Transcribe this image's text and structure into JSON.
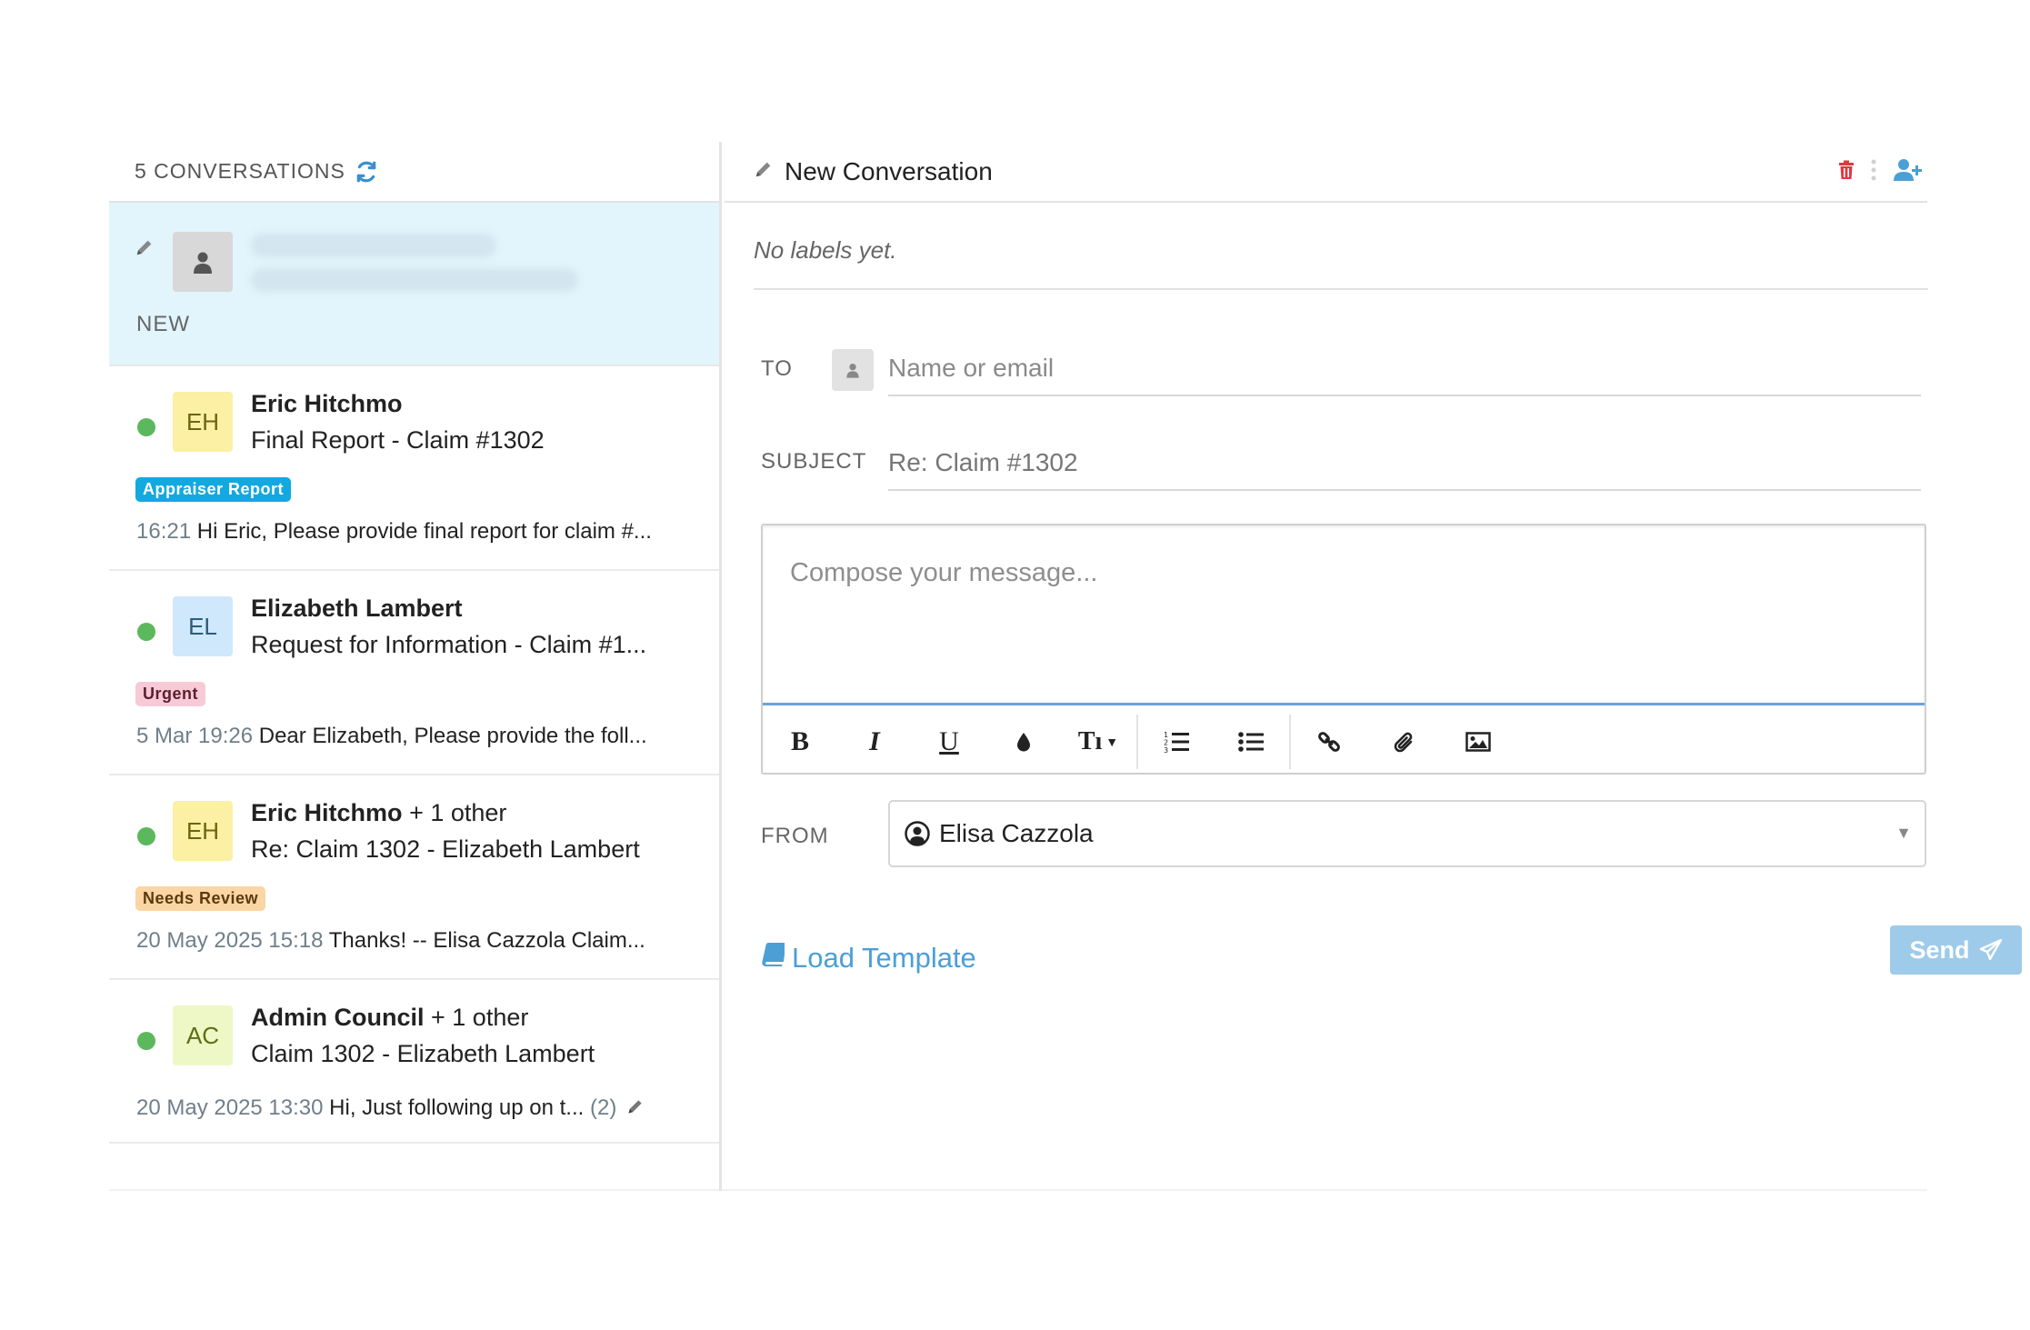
{
  "conversations_header": {
    "count_label": "5 CONVERSATIONS",
    "refresh_icon": "refresh-icon"
  },
  "new_item": {
    "label": "NEW"
  },
  "conversations": [
    {
      "initials": "EH",
      "name": "Eric Hitchmo",
      "extra": "",
      "subject": "Final Report - Claim #1302",
      "label": "Appraiser Report",
      "label_color": "#12a9e0",
      "time": "16:21",
      "preview": "Hi Eric, Please provide final report for claim #...",
      "status_color": "#5cb85c"
    },
    {
      "initials": "EL",
      "name": "Elizabeth Lambert",
      "extra": "",
      "subject": "Request for Information - Claim #1...",
      "label": "Urgent",
      "label_color": "#f8cad7",
      "time": "5 Mar 19:26",
      "preview": "Dear Elizabeth, Please provide the foll...",
      "status_color": "#5cb85c"
    },
    {
      "initials": "EH",
      "name": "Eric Hitchmo",
      "extra": "+ 1 other",
      "subject": "Re: Claim 1302 - Elizabeth Lambert",
      "label": "Needs Review",
      "label_color": "#fbd5a3",
      "time": "20 May 2025 15:18",
      "preview": "Thanks! -- Elisa Cazzola Claim...",
      "status_color": "#5cb85c"
    },
    {
      "initials": "AC",
      "name": "Admin Council",
      "extra": "+ 1 other",
      "subject": "Claim 1302 - Elizabeth Lambert",
      "label": "",
      "time": "20 May 2025 13:30",
      "preview": "Hi, Just following up on t...",
      "count": "(2)",
      "status_color": "#5cb85c"
    }
  ],
  "compose": {
    "title": "New Conversation",
    "no_labels": "No labels yet.",
    "to_label": "TO",
    "to_placeholder": "Name or email",
    "subject_label": "SUBJECT",
    "subject_value": "Re: Claim #1302",
    "message_placeholder": "Compose your message...",
    "from_label": "FROM",
    "from_value": "Elisa Cazzola",
    "load_template": "Load Template",
    "send": "Send",
    "delete_icon_color": "#e0393e",
    "accent_color": "#4c9fd4"
  },
  "toolbar": {
    "bold": "B",
    "italic": "I",
    "underline": "U",
    "text_size": "Tı"
  }
}
